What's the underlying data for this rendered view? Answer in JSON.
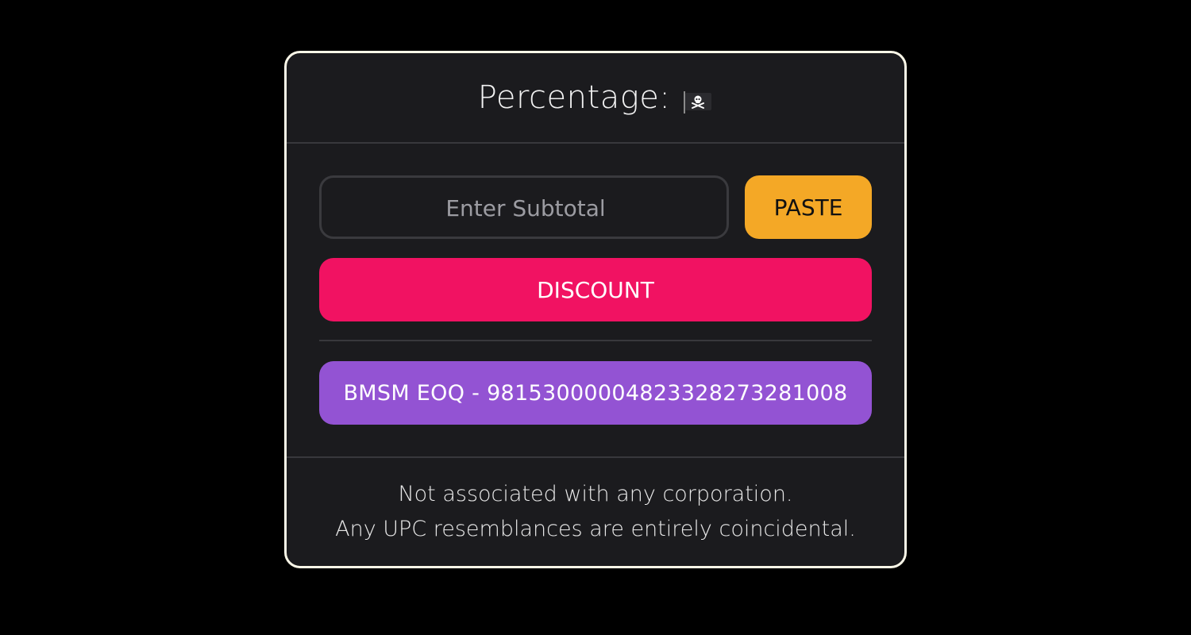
{
  "header": {
    "title": "Percentage:",
    "flag_icon": "pirate-flag-icon"
  },
  "form": {
    "subtotal_placeholder": "Enter Subtotal",
    "subtotal_value": "",
    "paste_label": "PASTE",
    "discount_label": "DISCOUNT"
  },
  "result": {
    "code_label": "BMSM EOQ - 98153000004823328273281008"
  },
  "footer": {
    "line1": "Not associated with any corporation.",
    "line2": "Any UPC resemblances are entirely coincidental."
  },
  "colors": {
    "background": "#000000",
    "card": "#1b1b1e",
    "card_border": "#fbf8e8",
    "paste": "#f4a826",
    "discount": "#f11262",
    "code": "#9353d3"
  }
}
